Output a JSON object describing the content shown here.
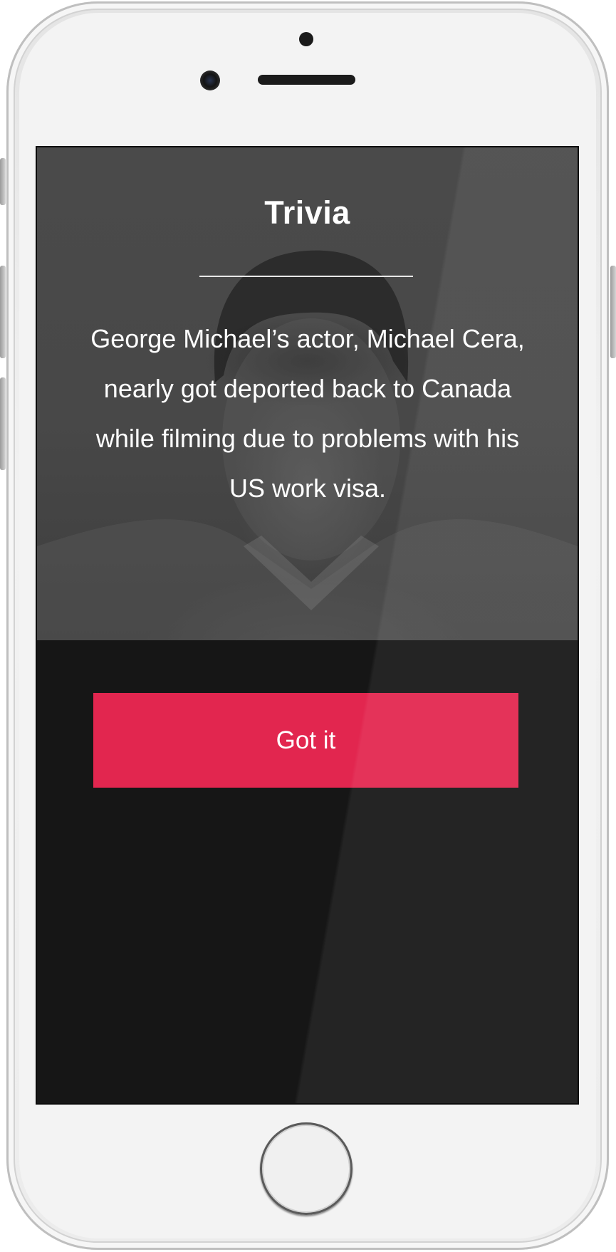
{
  "screen": {
    "title": "Trivia",
    "trivia_text": "George Michael’s actor, Michael Cera, nearly got deported back to Canada while filming due to problems with his US work visa.",
    "button_label": "Got it"
  },
  "colors": {
    "accent": "#e2264f",
    "background": "#161616",
    "text": "#ffffff"
  },
  "device": {
    "type": "phone",
    "home_button_icon": "home-button-icon"
  }
}
